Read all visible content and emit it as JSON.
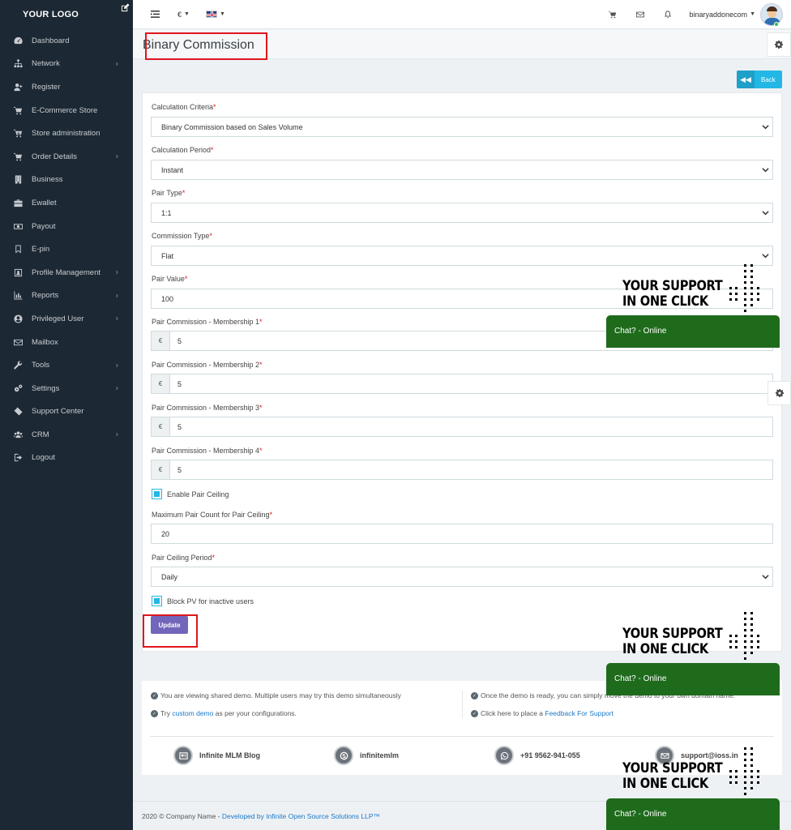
{
  "sidebar": {
    "logo": "YOUR LOGO",
    "items": [
      {
        "label": "Dashboard",
        "icon": "dashboard-icon",
        "has_children": false
      },
      {
        "label": "Network",
        "icon": "sitemap-icon",
        "has_children": true
      },
      {
        "label": "Register",
        "icon": "user-plus-icon",
        "has_children": false
      },
      {
        "label": "E-Commerce Store",
        "icon": "cart-icon",
        "has_children": false
      },
      {
        "label": "Store administration",
        "icon": "cart-arrow-icon",
        "has_children": false
      },
      {
        "label": "Order Details",
        "icon": "cart-icon",
        "has_children": true
      },
      {
        "label": "Business",
        "icon": "building-icon",
        "has_children": false
      },
      {
        "label": "Ewallet",
        "icon": "briefcase-icon",
        "has_children": false
      },
      {
        "label": "Payout",
        "icon": "money-icon",
        "has_children": false
      },
      {
        "label": "E-pin",
        "icon": "bookmark-icon",
        "has_children": false
      },
      {
        "label": "Profile Management",
        "icon": "id-card-icon",
        "has_children": true
      },
      {
        "label": "Reports",
        "icon": "bar-chart-icon",
        "has_children": true
      },
      {
        "label": "Privileged User",
        "icon": "user-circle-icon",
        "has_children": true
      },
      {
        "label": "Mailbox",
        "icon": "envelope-icon",
        "has_children": false
      },
      {
        "label": "Tools",
        "icon": "wrench-icon",
        "has_children": true
      },
      {
        "label": "Settings",
        "icon": "cogs-icon",
        "has_children": true
      },
      {
        "label": "Support Center",
        "icon": "ticket-icon",
        "has_children": false
      },
      {
        "label": "CRM",
        "icon": "users-icon",
        "has_children": true
      },
      {
        "label": "Logout",
        "icon": "logout-icon",
        "has_children": false
      }
    ]
  },
  "topbar": {
    "currency": "€",
    "username": "binaryaddonecom"
  },
  "page": {
    "title": "Binary Commission",
    "back_label": "Back"
  },
  "form": {
    "calc_criteria": {
      "label": "Calculation Criteria",
      "value": "Binary Commission based on Sales Volume"
    },
    "calc_period": {
      "label": "Calculation Period",
      "value": "Instant"
    },
    "pair_type": {
      "label": "Pair Type",
      "value": "1:1"
    },
    "commission_type": {
      "label": "Commission Type",
      "value": "Flat"
    },
    "pair_value": {
      "label": "Pair Value",
      "value": "100"
    },
    "membership1": {
      "label": "Pair Commission - Membership 1",
      "addon": "€",
      "value": "5"
    },
    "membership2": {
      "label": "Pair Commission - Membership 2",
      "addon": "€",
      "value": "5"
    },
    "membership3": {
      "label": "Pair Commission - Membership 3",
      "addon": "€",
      "value": "5"
    },
    "membership4": {
      "label": "Pair Commission - Membership 4",
      "addon": "€",
      "value": "5"
    },
    "enable_ceiling": {
      "label": "Enable Pair Ceiling",
      "checked": true
    },
    "max_pair": {
      "label": "Maximum Pair Count for Pair Ceiling",
      "value": "20"
    },
    "ceiling_period": {
      "label": "Pair Ceiling Period",
      "value": "Daily"
    },
    "block_pv": {
      "label": "Block PV for inactive users",
      "checked": true
    },
    "update_label": "Update",
    "required_mark": "*"
  },
  "info": {
    "left1": "You are viewing shared demo. Multiple users may try this demo simultaneously",
    "left2_pre": "Try ",
    "left2_link": "custom demo",
    "left2_post": " as per your configurations.",
    "right1": "Once the demo is ready, you can simply move the demo to your own domain name.",
    "right2_pre": "Click here to place a ",
    "right2_link": "Feedback For Support",
    "social": [
      {
        "label": "Infinite MLM Blog",
        "icon": "blog-icon"
      },
      {
        "label": "infinitemlm",
        "icon": "skype-icon"
      },
      {
        "label": "+91 9562-941-055",
        "icon": "whatsapp-icon"
      },
      {
        "label": "support@ioss.in",
        "icon": "envelope-icon"
      }
    ]
  },
  "footer": {
    "copyright": "2020 © Company Name - ",
    "developer": "Developed by Infinite Open Source Solutions LLP™"
  },
  "support_widget": {
    "line1": "YOUR SUPPORT",
    "line2": "IN ONE CLICK",
    "chat": "Chat? - Online"
  },
  "colors": {
    "sidebar": "#1c2833",
    "accent": "#23b7e5",
    "update_button": "#7266ba",
    "chat": "#1e6b1c",
    "highlight": "#e0161d"
  }
}
